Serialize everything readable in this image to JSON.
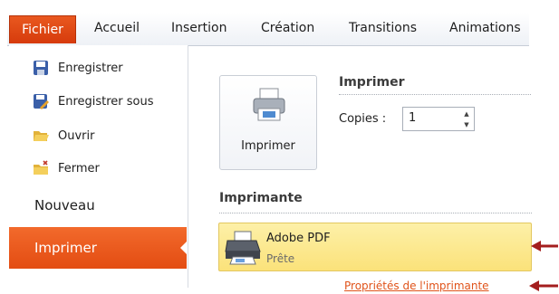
{
  "ribbon": {
    "tabs": [
      {
        "label": "Fichier",
        "active": true
      },
      {
        "label": "Accueil"
      },
      {
        "label": "Insertion"
      },
      {
        "label": "Création"
      },
      {
        "label": "Transitions"
      },
      {
        "label": "Animations"
      }
    ],
    "active_color": "#e34c12"
  },
  "backstage_menu": {
    "items": [
      {
        "label": "Enregistrer",
        "icon": "save-icon"
      },
      {
        "label": "Enregistrer sous",
        "icon": "save-as-icon"
      },
      {
        "label": "Ouvrir",
        "icon": "open-folder-icon"
      },
      {
        "label": "Fermer",
        "icon": "close-folder-icon"
      }
    ],
    "nouveau_label": "Nouveau",
    "imprimer_label": "Imprimer"
  },
  "print": {
    "button_label": "Imprimer",
    "section_title": "Imprimer",
    "copies_label": "Copies :",
    "copies_value": "1"
  },
  "printer": {
    "section_title": "Imprimante",
    "name": "Adobe PDF",
    "status": "Prête",
    "properties_link": "Propriétés de l'imprimante"
  },
  "annotations": {
    "arrow_color": "#a41e1e"
  }
}
